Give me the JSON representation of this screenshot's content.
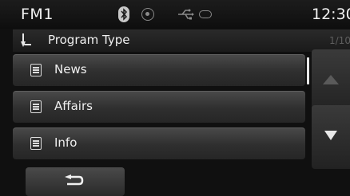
{
  "status_bar": {
    "band": "FM1",
    "clock": "12:30",
    "icons": [
      "bluetooth-icon",
      "radio-icon",
      "usb-icon",
      "battery-icon"
    ]
  },
  "title_bar": {
    "title": "Program Type",
    "page": "1/10",
    "icon": "back-arrow-icon"
  },
  "list": {
    "items": [
      {
        "label": "News",
        "icon": "list-icon"
      },
      {
        "label": "Affairs",
        "icon": "list-icon"
      },
      {
        "label": "Info",
        "icon": "list-icon"
      }
    ]
  },
  "scroll": {
    "up_icon": "triangle-up-icon",
    "down_icon": "triangle-down-icon"
  },
  "bottom": {
    "back_icon": "return-arrow-icon"
  },
  "colors": {
    "background": "#101010",
    "text": "#f0f0f0",
    "button_top": "#4a4a4a",
    "button_bottom": "#262626",
    "corner_mark": "#e0303a"
  }
}
